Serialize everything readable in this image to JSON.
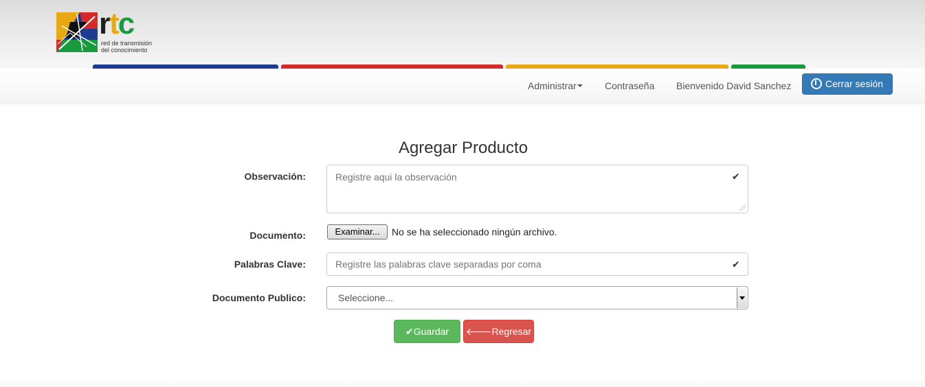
{
  "brand": {
    "letters": "rtc",
    "tagline_line1": "red de transmisión",
    "tagline_line2": "del conocimiento",
    "colors": {
      "blue": "#1f3b8f",
      "red": "#d32a2a",
      "yellow": "#e8a914",
      "green": "#1a9a3e"
    }
  },
  "nav": {
    "admin_label": "Administrar",
    "password_label": "Contraseña",
    "welcome_label": "Bienvenido David Sanchez",
    "logout_label": "Cerrar sesión"
  },
  "page": {
    "title": "Agregar Producto"
  },
  "form": {
    "observacion": {
      "label": "Observación:",
      "placeholder": "Registre aqui la observación"
    },
    "documento": {
      "label": "Documento:",
      "button_label": "Examinar...",
      "status": "No se ha seleccionado ningún archivo."
    },
    "palabras": {
      "label": "Palabras Clave:",
      "placeholder": "Registre las palabras clave separadas por coma"
    },
    "publico": {
      "label": "Documento Publico:",
      "selected": "Seleccione..."
    },
    "save_label": "Guardar",
    "back_label": "Regresar"
  },
  "icons": {
    "check": "check-icon",
    "power": "power-icon",
    "arrow": "arrow-left-icon"
  }
}
